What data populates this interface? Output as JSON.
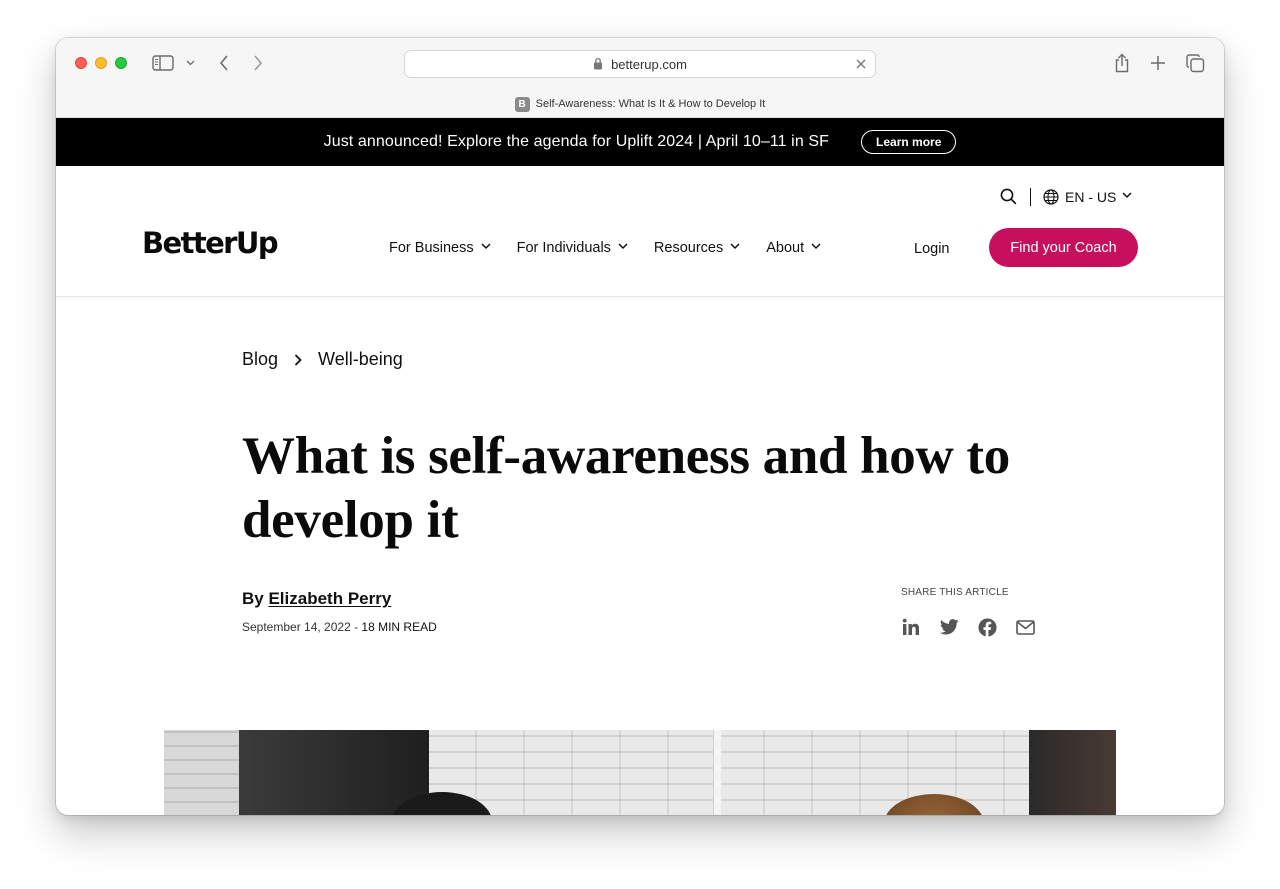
{
  "browser": {
    "url": "betterup.com",
    "tab_title": "Self-Awareness: What Is It & How to Develop It",
    "favicon_letter": "B"
  },
  "announcement": {
    "text": "Just announced! Explore the agenda for Uplift 2024 | April 10–11 in SF",
    "button": "Learn more"
  },
  "header": {
    "language": "EN - US",
    "logo": "BetterUp",
    "nav": [
      {
        "label": "For Business"
      },
      {
        "label": "For Individuals"
      },
      {
        "label": "Resources"
      },
      {
        "label": "About"
      }
    ],
    "login": "Login",
    "cta": "Find your Coach",
    "cta_color": "#c7105d"
  },
  "article": {
    "breadcrumb": [
      "Blog",
      "Well-being"
    ],
    "title": "What is self-awareness and how to develop it",
    "by": "By",
    "author": "Elizabeth Perry",
    "date": "September 14, 2022",
    "separator": " - ",
    "read_time": "18 MIN READ",
    "share_label": "SHARE THIS ARTICLE",
    "share_icons": [
      "linkedin-icon",
      "twitter-icon",
      "facebook-icon",
      "email-icon"
    ]
  }
}
